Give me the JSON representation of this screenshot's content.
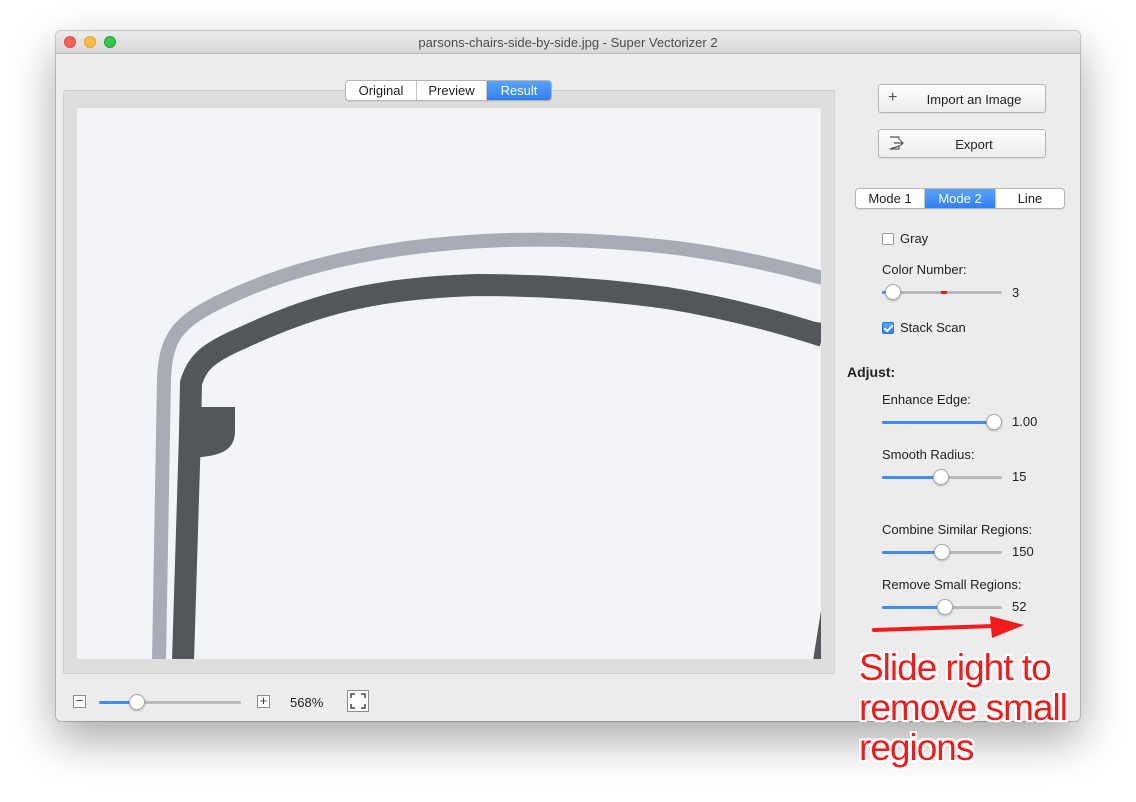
{
  "window": {
    "title": "parsons-chairs-side-by-side.jpg - Super Vectorizer 2"
  },
  "view_tabs": {
    "items": [
      "Original",
      "Preview",
      "Result"
    ],
    "selected": "Result"
  },
  "sidebar": {
    "import_label": "Import an Image",
    "import_icon": "plus-icon",
    "export_label": "Export",
    "export_icon": "export-icon",
    "mode_tabs": {
      "items": [
        "Mode 1",
        "Mode 2",
        "Line"
      ],
      "selected": "Mode 2"
    },
    "gray": {
      "label": "Gray",
      "checked": false
    },
    "color_number": {
      "label": "Color Number:",
      "value": "3",
      "level": 0.09
    },
    "stack_scan": {
      "label": "Stack Scan",
      "checked": true
    },
    "adjust_heading": "Adjust:",
    "enhance_edge": {
      "label": "Enhance Edge:",
      "value": "1.00",
      "level": 0.93
    },
    "smooth_radius": {
      "label": "Smooth Radius:",
      "value": "15",
      "level": 0.49
    },
    "combine_similar": {
      "label": "Combine Similar Regions:",
      "value": "150",
      "level": 0.5
    },
    "remove_small": {
      "label": "Remove Small Regions:",
      "value": "52",
      "level": 0.53
    }
  },
  "bottom_bar": {
    "zoom_out_icon": "minus-icon",
    "zoom_in_icon": "plus-icon",
    "zoom_value": "568%",
    "zoom_level": 0.27,
    "fit_icon": "fit-screen-icon"
  },
  "annotation": {
    "text": "Slide right to\nremove small\nregions",
    "color": "#f21b1b"
  },
  "colors": {
    "accent": "#3d8df5",
    "shape_light": "#a8adb5",
    "shape_dark": "#53565b",
    "canvas_bg": "#f3f4f8"
  }
}
